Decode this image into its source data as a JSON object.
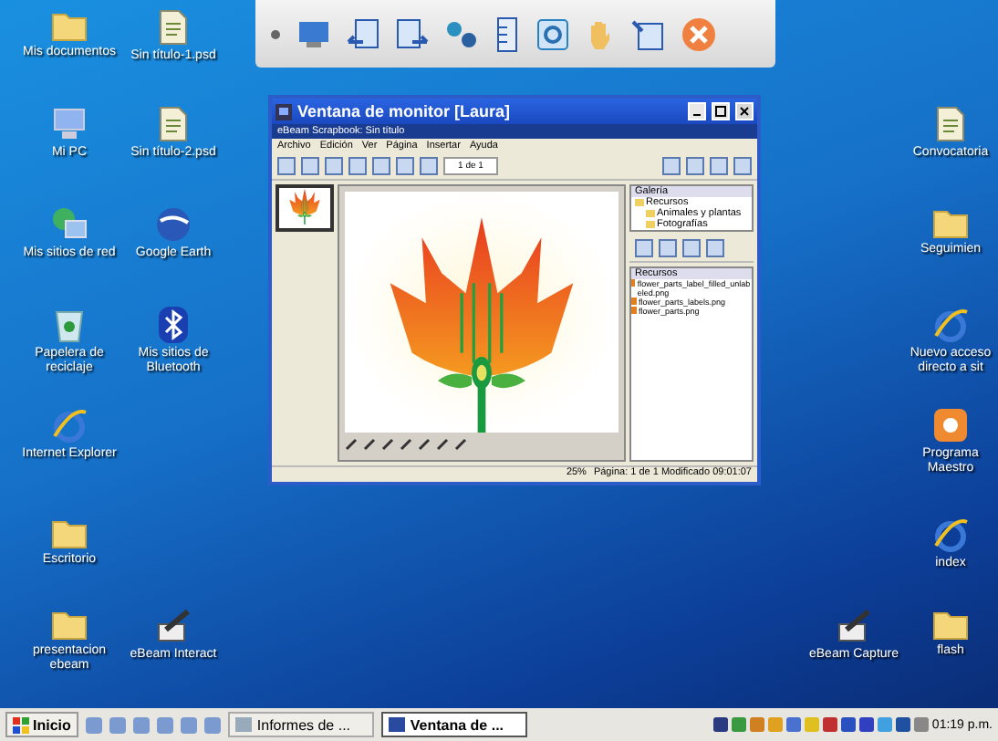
{
  "desktop_icons": [
    {
      "label": "Mis documentos",
      "kind": "folder"
    },
    {
      "label": "Sin título-1.psd",
      "kind": "file"
    },
    {
      "label": "Mi PC",
      "kind": "computer"
    },
    {
      "label": "Sin título-2.psd",
      "kind": "file"
    },
    {
      "label": "Mis sitios de red",
      "kind": "network"
    },
    {
      "label": "Google Earth",
      "kind": "globe"
    },
    {
      "label": "Papelera de reciclaje",
      "kind": "recycle"
    },
    {
      "label": "Mis sitios de Bluetooth",
      "kind": "bluetooth"
    },
    {
      "label": "Internet Explorer",
      "kind": "browser"
    },
    {
      "label": "Escritorio",
      "kind": "folder"
    },
    {
      "label": "presentacion ebeam",
      "kind": "folder"
    },
    {
      "label": "eBeam Interact",
      "kind": "pen"
    },
    {
      "label": "Convocatoria",
      "kind": "file"
    },
    {
      "label": "Seguimien",
      "kind": "folder"
    },
    {
      "label": "Nuevo acceso directo a sit",
      "kind": "browser"
    },
    {
      "label": "Programa Maestro",
      "kind": "app"
    },
    {
      "label": "index",
      "kind": "browser"
    },
    {
      "label": "eBeam Capture",
      "kind": "pen"
    },
    {
      "label": "flash",
      "kind": "folder"
    }
  ],
  "window": {
    "title": "Ventana de monitor [Laura]",
    "inner_title": "eBeam Scrapbook: Sin título",
    "menu": [
      "Archivo",
      "Edición",
      "Ver",
      "Página",
      "Insertar",
      "Ayuda"
    ],
    "page_field": "1 de 1",
    "gallery": {
      "title": "Galería",
      "tree": [
        {
          "label": "Recursos",
          "children": [
            {
              "label": "Animales y plantas"
            },
            {
              "label": "Fotografías"
            }
          ]
        }
      ]
    },
    "resources": {
      "title": "Recursos",
      "files": [
        "flower_parts_label_filled_unlabeled.png",
        "flower_parts_labels.png",
        "flower_parts.png"
      ]
    },
    "status": {
      "zoom": "25%",
      "page": "Página: 1 de 1  Modificado 09:01:07"
    }
  },
  "taskbar": {
    "start": "Inicio",
    "tasks": [
      {
        "label": "Informes de ...",
        "selected": false
      },
      {
        "label": "Ventana de ...",
        "selected": true
      }
    ],
    "clock": "01:19 p.m."
  }
}
